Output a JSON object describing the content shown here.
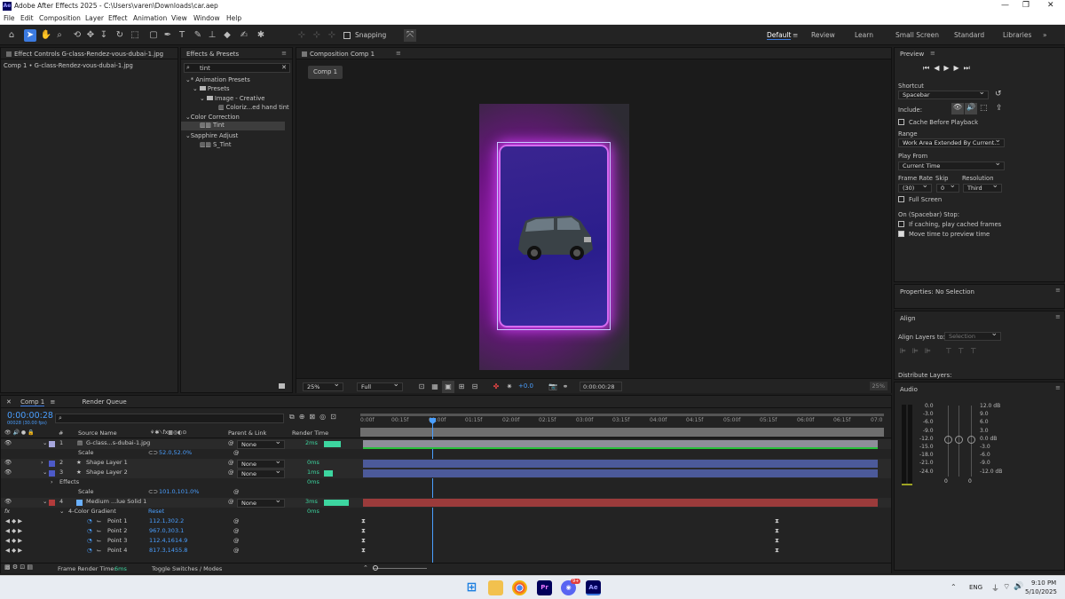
{
  "app": {
    "title": "Adobe After Effects 2025 - C:\\Users\\varen\\Downloads\\car.aep",
    "logo": "Ae",
    "menu": [
      "File",
      "Edit",
      "Composition",
      "Layer",
      "Effect",
      "Animation",
      "View",
      "Window",
      "Help"
    ]
  },
  "toolbar": {
    "snapping_label": "Snapping",
    "workspaces": [
      "Default",
      "Review",
      "Learn",
      "Small Screen",
      "Standard",
      "Libraries"
    ],
    "active_workspace": "Default"
  },
  "effect_controls": {
    "tab_label": "Effect Controls G-class-Rendez-vous-dubai-1.jpg",
    "breadcrumb": "Comp 1 • G-class-Rendez-vous-dubai-1.jpg"
  },
  "effects_presets": {
    "tab_label": "Effects & Presets",
    "search_value": "tint",
    "tree": [
      {
        "label": "* Animation Presets",
        "level": 0,
        "type": "toggle"
      },
      {
        "label": "Presets",
        "level": 1,
        "type": "folder"
      },
      {
        "label": "Image - Creative",
        "level": 2,
        "type": "folder"
      },
      {
        "label": "Coloriz...ed hand tint",
        "level": 3,
        "type": "preset"
      },
      {
        "label": "Color Correction",
        "level": 0,
        "type": "toggle"
      },
      {
        "label": "Tint",
        "level": 1,
        "type": "effect",
        "selected": true
      },
      {
        "label": "Sapphire Adjust",
        "level": 0,
        "type": "toggle"
      },
      {
        "label": "S_Tint",
        "level": 1,
        "type": "effect"
      }
    ]
  },
  "composition": {
    "tab_label": "Composition Comp 1",
    "comp_chip": "Comp 1",
    "zoom": "25%",
    "resolution": "Full",
    "exposure": "+0.0",
    "timecode": "0:00:00:28",
    "right_zoom": "25%"
  },
  "preview": {
    "tab_label": "Preview",
    "shortcut_label": "Shortcut",
    "shortcut_value": "Spacebar",
    "include_label": "Include:",
    "cache_before_playback": "Cache Before Playback",
    "range_label": "Range",
    "range_value": "Work Area Extended By Current...",
    "play_from_label": "Play From",
    "play_from_value": "Current Time",
    "frame_rate_label": "Frame Rate",
    "skip_label": "Skip",
    "resolution_label": "Resolution",
    "frame_rate_value": "(30)",
    "skip_value": "0",
    "resolution_value": "Third",
    "full_screen": "Full Screen",
    "on_stop_label": "On (Spacebar) Stop:",
    "if_caching": "If caching, play cached frames",
    "move_time": "Move time to preview time",
    "move_time_checked": true
  },
  "properties": {
    "tab_label": "Properties: No Selection"
  },
  "align": {
    "tab_label": "Align",
    "align_layers_to": "Align Layers to:",
    "align_value": "Selection",
    "distribute_label": "Distribute Layers:"
  },
  "audio": {
    "tab_label": "Audio",
    "left_scale": [
      "0.0",
      "-3.0",
      "-6.0",
      "-9.0",
      "-12.0",
      "-15.0",
      "-18.0",
      "-21.0",
      "-24.0"
    ],
    "right_scale": [
      "12.0 dB",
      "9.0",
      "6.0",
      "3.0",
      "0.0 dB",
      "-3.0",
      "-6.0",
      "-9.0",
      "-12.0 dB"
    ],
    "fader_left": "0",
    "fader_right": "0"
  },
  "timeline": {
    "tab_comp": "Comp 1",
    "tab_queue": "Render Queue",
    "current_time": "0:00:00:28",
    "fps_info": "00028 (30.00 fps)",
    "col_num": "#",
    "col_source": "Source Name",
    "col_parent": "Parent & Link",
    "col_render": "Render Time",
    "ruler": [
      "0:00f",
      "00:15f",
      "01:00f",
      "01:15f",
      "02:00f",
      "02:15f",
      "03:00f",
      "03:15f",
      "04:00f",
      "04:15f",
      "05:00f",
      "05:15f",
      "06:00f",
      "06:15f",
      "07:0"
    ],
    "frame_render_label": "Frame Render Time:",
    "frame_render_value": "6ms",
    "toggle_label": "Toggle Switches / Modes",
    "layers": [
      {
        "num": "1",
        "name": "G-class...s-dubai-1.jpg",
        "parent": "None",
        "render": "2ms",
        "label_color": "#a6a6dc",
        "bar_color": "#8e8e9a"
      },
      {
        "prop": "Scale",
        "value": "52.0,52.0%"
      },
      {
        "num": "2",
        "name": "Shape Layer 1",
        "parent": "None",
        "render": "0ms",
        "label_color": "#4d5ac8",
        "bar_color": "#4c5a9a"
      },
      {
        "num": "3",
        "name": "Shape Layer 2",
        "parent": "None",
        "render": "1ms",
        "label_color": "#4d5ac8",
        "bar_color": "#4c5a9a"
      },
      {
        "sub": "Effects",
        "render": "0ms"
      },
      {
        "prop": "Scale",
        "value": "101.0,101.0%"
      },
      {
        "num": "4",
        "name": "Medium ...lue Solid 1",
        "parent": "None",
        "render": "3ms",
        "label_color": "#b33b3b",
        "bar_color": "#9b3b3b"
      },
      {
        "effect": "4-Color Gradient",
        "reset": "Reset",
        "render": "0ms"
      },
      {
        "prop": "Point 1",
        "value": "112.1,302.2"
      },
      {
        "prop": "Point 2",
        "value": "967.0,303.1"
      },
      {
        "prop": "Point 3",
        "value": "112.4,1614.9"
      },
      {
        "prop": "Point 4",
        "value": "817.3,1455.8"
      }
    ]
  },
  "taskbar": {
    "lang": "ENG",
    "time": "9:10 PM",
    "date": "5/10/2025",
    "apps": [
      "windows-start",
      "file-explorer",
      "chrome",
      "premiere-pro",
      "discord",
      "after-effects"
    ],
    "discord_badge": "9+"
  },
  "colors": {
    "accent": "#3b7ae0",
    "value_blue": "#4a9fff",
    "render_green": "#3dd6a0"
  }
}
